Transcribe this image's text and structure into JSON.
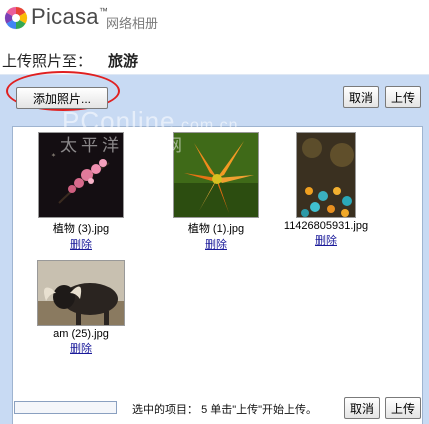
{
  "header": {
    "brand": "Picasa",
    "trademark": "™",
    "subtitle": "网络相册"
  },
  "upload_target": {
    "label": "上传照片至：",
    "album": "旅游"
  },
  "toolbar": {
    "add_label": "添加照片...",
    "cancel_label": "取消",
    "upload_label": "上传"
  },
  "photos": [
    {
      "filename": "植物 (3).jpg",
      "delete_label": "删除"
    },
    {
      "filename": "植物 (1).jpg",
      "delete_label": "删除"
    },
    {
      "filename": "11426805931.jpg",
      "delete_label": "删除"
    },
    {
      "filename": "am (25).jpg",
      "delete_label": "删除"
    }
  ],
  "footer": {
    "selected_label": "选中的项目：",
    "selected_count": "5",
    "hint": "单击\"上传\"开始上传。",
    "cancel_label": "取消",
    "upload_label": "上传",
    "progress": 0
  },
  "watermark": {
    "main": "PConline",
    "suffix": ".com.cn",
    "sub": "太平洋电脑网"
  },
  "colors": {
    "panel_bg": "#c8daf3",
    "highlight_ellipse": "#e02020",
    "link": "#1a1a9a"
  }
}
